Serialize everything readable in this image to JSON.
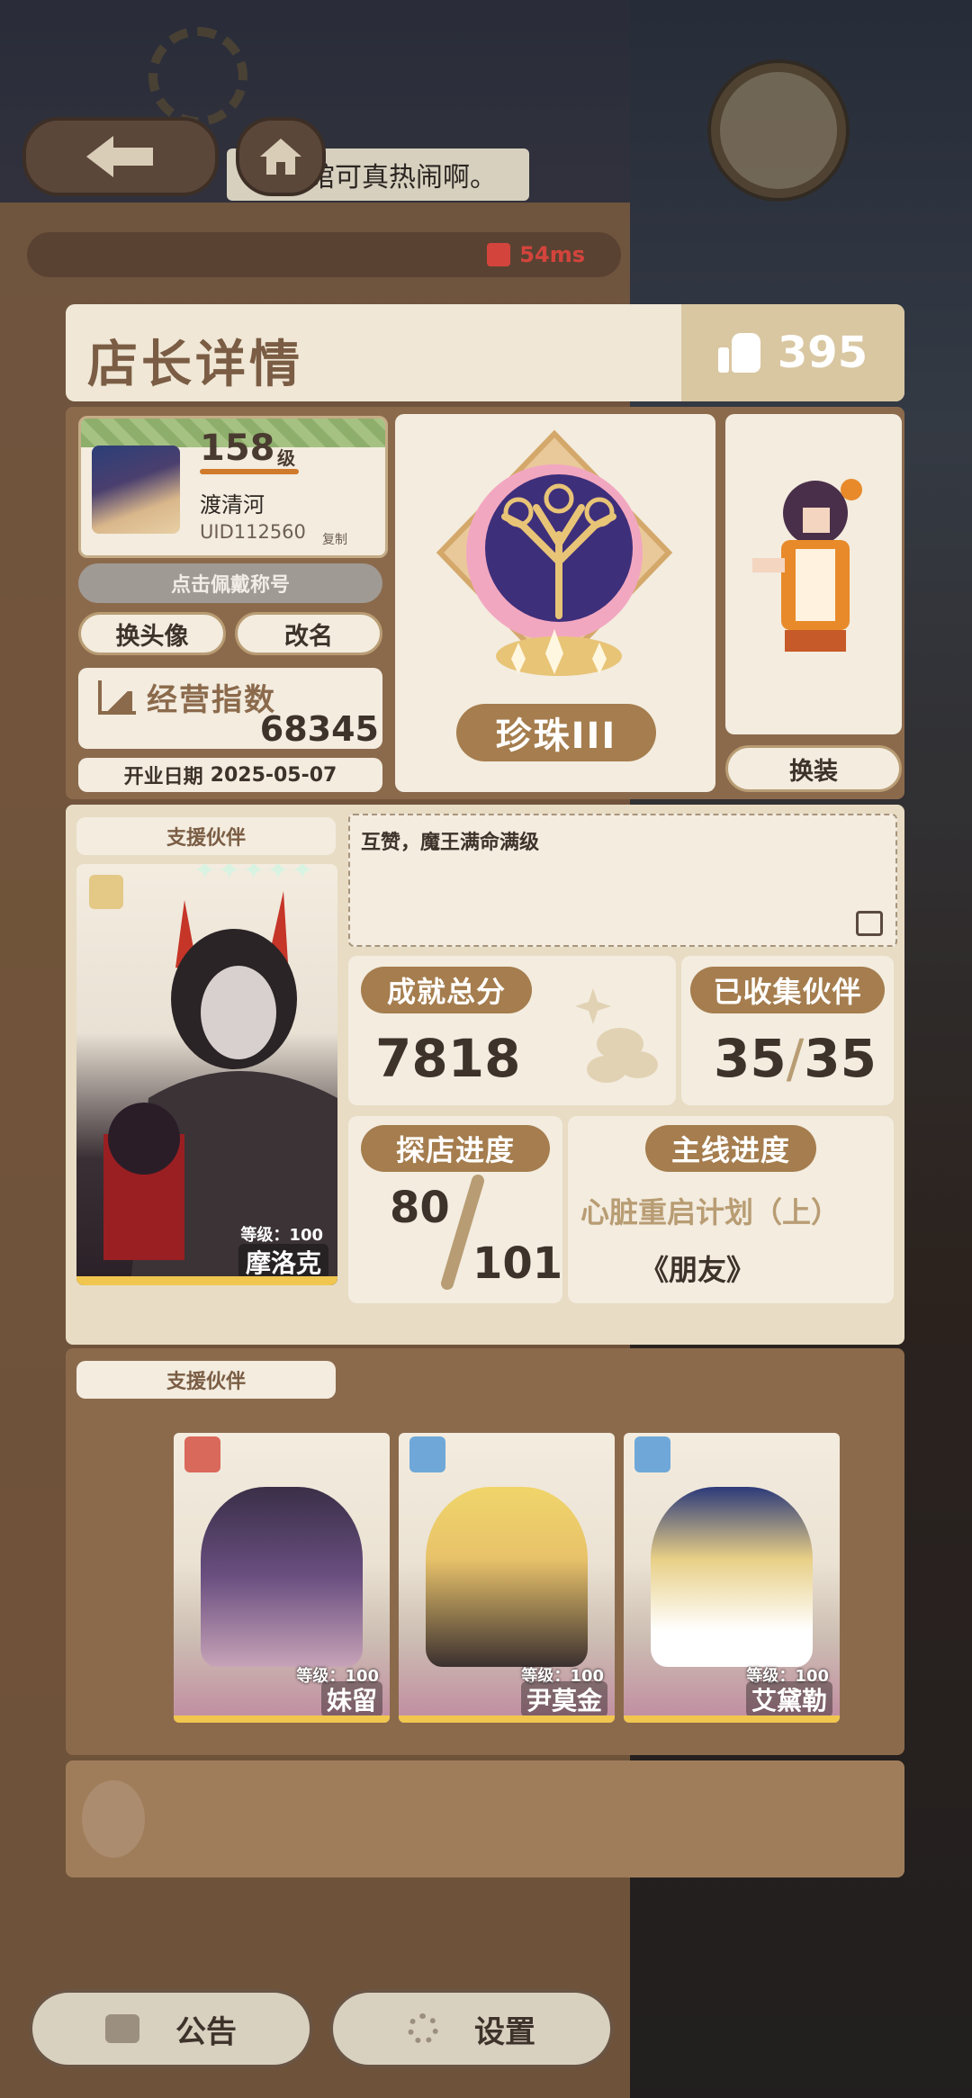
{
  "nav": {
    "marquee_text": "馆可真热闹啊。"
  },
  "status": {
    "ping": "54ms"
  },
  "panel": {
    "title": "店长详情",
    "likes": "395"
  },
  "profile": {
    "level": "158",
    "level_unit": "级",
    "name": "渡清河",
    "uid": "UID112560",
    "copy_label": "复制",
    "equip_title_label": "点击佩戴称号",
    "change_avatar_label": "换头像",
    "rename_label": "改名",
    "business_index_label": "经营指数",
    "business_index_value": "68345",
    "open_date_label": "开业日期",
    "open_date_value": "2025-05-07"
  },
  "rank": {
    "name": "珍珠III"
  },
  "outfit": {
    "change_label": "换装"
  },
  "support": {
    "label": "支援伙伴",
    "featured": {
      "level_text": "等级：100",
      "name": "摩洛克",
      "stars": "✦✦✦✦✦"
    },
    "message": "互赞，魔王满命满级"
  },
  "stats": {
    "achievement_label": "成就总分",
    "achievement_value": "7818",
    "collected_label": "已收集伙伴",
    "collected_have": "35",
    "collected_total": "35",
    "explore_label": "探店进度",
    "explore_done": "80",
    "explore_total": "101",
    "story_label": "主线进度",
    "story_chapter": "心脏重启计划（上）",
    "story_episode": "《朋友》"
  },
  "support_team": {
    "label": "支援伙伴",
    "members": [
      {
        "level_text": "等级：100",
        "name": "妹留"
      },
      {
        "level_text": "等级：100",
        "name": "尹莫金"
      },
      {
        "level_text": "等级：100",
        "name": "艾黛勒"
      }
    ]
  },
  "bottom": {
    "notice_label": "公告",
    "settings_label": "设置"
  },
  "colors": {
    "accent_brown": "#a57d4e",
    "panel_cream": "#f3ecdf",
    "ping_red": "#d3443c"
  }
}
